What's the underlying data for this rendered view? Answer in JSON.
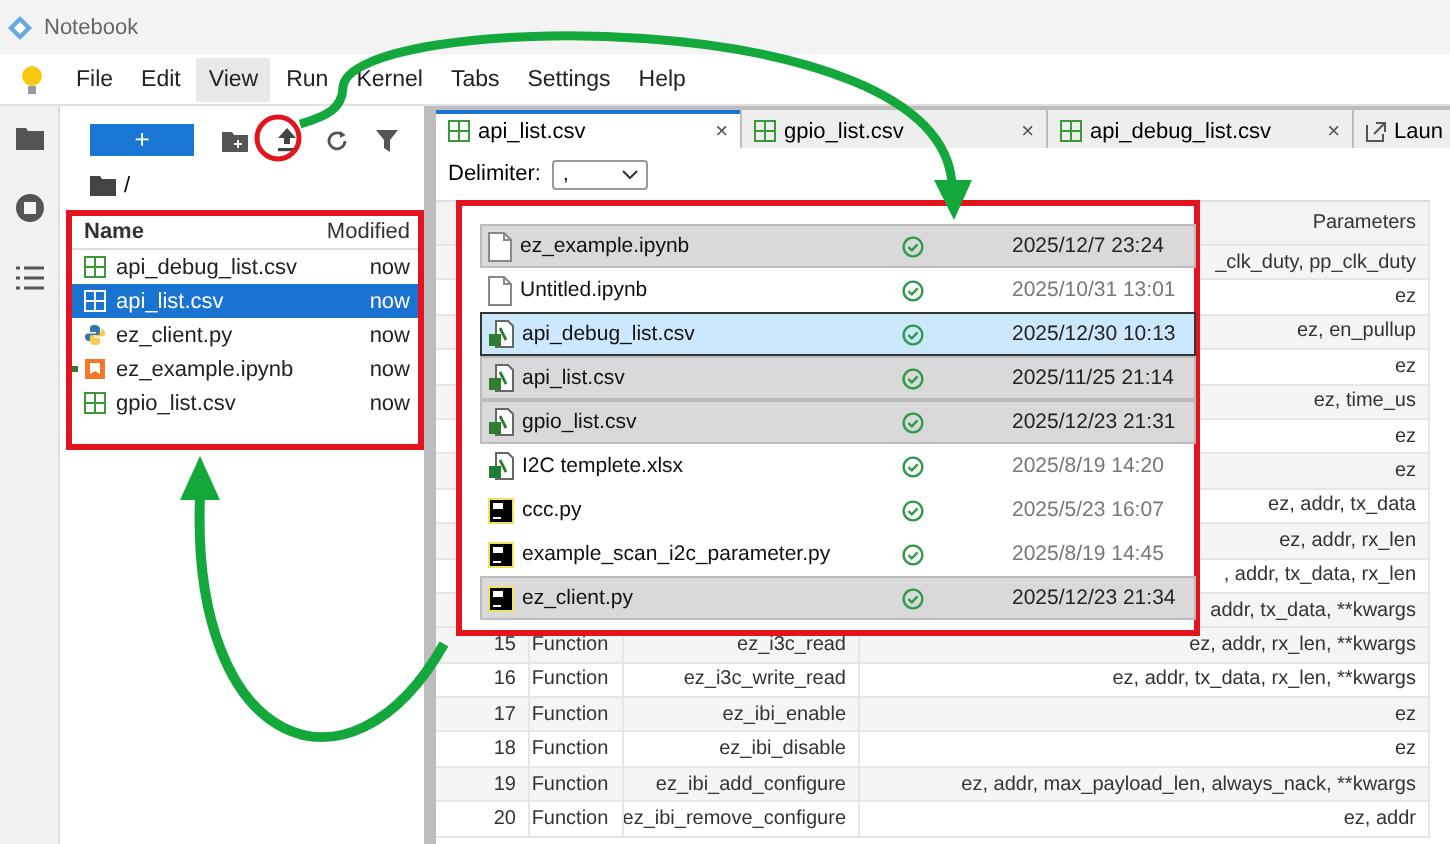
{
  "window": {
    "title": "Notebook"
  },
  "menu": [
    {
      "label": "File",
      "selected": false
    },
    {
      "label": "Edit",
      "selected": false
    },
    {
      "label": "View",
      "selected": true
    },
    {
      "label": "Run",
      "selected": false
    },
    {
      "label": "Kernel",
      "selected": false
    },
    {
      "label": "Tabs",
      "selected": false
    },
    {
      "label": "Settings",
      "selected": false
    },
    {
      "label": "Help",
      "selected": false
    }
  ],
  "file_browser": {
    "new_button": "+",
    "path": "/",
    "columns": [
      "Name",
      "Modified"
    ],
    "items": [
      {
        "name": "api_debug_list.csv",
        "modified": "now",
        "kind": "csv",
        "selected": false,
        "running": false
      },
      {
        "name": "api_list.csv",
        "modified": "now",
        "kind": "csv",
        "selected": true,
        "running": false
      },
      {
        "name": "ez_client.py",
        "modified": "now",
        "kind": "python",
        "selected": false,
        "running": false
      },
      {
        "name": "ez_example.ipynb",
        "modified": "now",
        "kind": "notebook",
        "selected": false,
        "running": true
      },
      {
        "name": "gpio_list.csv",
        "modified": "now",
        "kind": "csv",
        "selected": false,
        "running": false
      }
    ]
  },
  "tabs": [
    {
      "label": "api_list.csv",
      "kind": "csv",
      "close": "×",
      "selected": true
    },
    {
      "label": "gpio_list.csv",
      "kind": "csv",
      "close": "×",
      "selected": false
    },
    {
      "label": "api_debug_list.csv",
      "kind": "csv",
      "close": "×",
      "selected": false
    },
    {
      "label": "Laun",
      "kind": "launcher",
      "selected": false
    }
  ],
  "delimiter": {
    "label": "Delimiter:",
    "value": ","
  },
  "table": {
    "header": "Parameters",
    "covered_rows": [
      "_clk_duty, pp_clk_duty",
      "ez",
      "ez, en_pullup",
      "ez",
      "ez, time_us",
      "ez",
      "ez",
      "ez, addr, tx_data",
      "ez, addr, rx_len",
      ", addr, tx_data, rx_len",
      "addr, tx_data, **kwargs"
    ],
    "rows": [
      [
        "15",
        "Function",
        "ez_i3c_read",
        "ez, addr, rx_len, **kwargs"
      ],
      [
        "16",
        "Function",
        "ez_i3c_write_read",
        "ez, addr, tx_data, rx_len, **kwargs"
      ],
      [
        "17",
        "Function",
        "ez_ibi_enable",
        "ez"
      ],
      [
        "18",
        "Function",
        "ez_ibi_disable",
        "ez"
      ],
      [
        "19",
        "Function",
        "ez_ibi_add_configure",
        "ez, addr, max_payload_len, always_nack, **kwargs"
      ],
      [
        "20",
        "Function",
        "ez_ibi_remove_configure",
        "ez, addr"
      ]
    ]
  },
  "explorer": [
    {
      "name": "ez_example.ipynb",
      "date": "2025/12/7 23:24",
      "kind": "notebook",
      "selected": true,
      "focused": false
    },
    {
      "name": "Untitled.ipynb",
      "date": "2025/10/31 13:01",
      "kind": "notebook",
      "selected": false,
      "focused": false
    },
    {
      "name": "api_debug_list.csv",
      "date": "2025/12/30 10:13",
      "kind": "csv",
      "selected": true,
      "focused": true
    },
    {
      "name": "api_list.csv",
      "date": "2025/11/25 21:14",
      "kind": "csv",
      "selected": true,
      "focused": false
    },
    {
      "name": "gpio_list.csv",
      "date": "2025/12/23 21:31",
      "kind": "csv",
      "selected": true,
      "focused": false
    },
    {
      "name": "I2C templete.xlsx",
      "date": "2025/8/19 14:20",
      "kind": "xlsx",
      "selected": false,
      "focused": false
    },
    {
      "name": "ccc.py",
      "date": "2025/5/23 16:07",
      "kind": "pycharm",
      "selected": false,
      "focused": false
    },
    {
      "name": "example_scan_i2c_parameter.py",
      "date": "2025/8/19 14:45",
      "kind": "pycharm",
      "selected": false,
      "focused": false
    },
    {
      "name": "ez_client.py",
      "date": "2025/12/23 21:34",
      "kind": "pycharm",
      "selected": true,
      "focused": false
    }
  ]
}
